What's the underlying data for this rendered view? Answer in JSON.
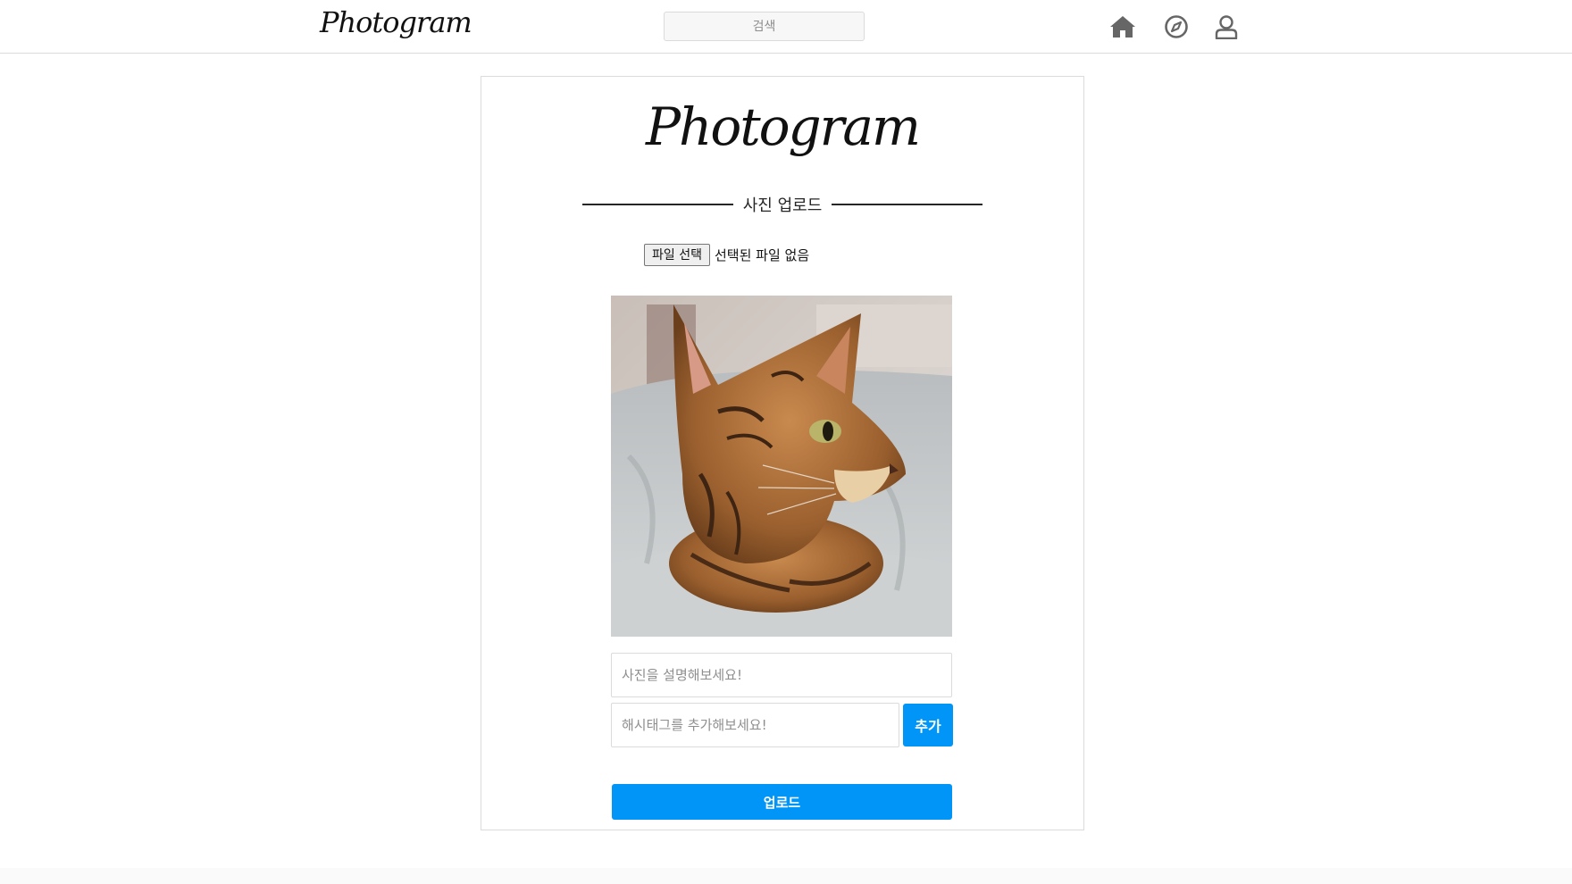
{
  "header": {
    "logo_text": "Photogram",
    "search_placeholder": "검색",
    "nav_icons": [
      "home-icon",
      "compass-icon",
      "user-icon"
    ]
  },
  "upload_card": {
    "logo_text": "Photogram",
    "section_title": "사진 업로드",
    "file_button_label": "파일 선택",
    "file_status": "선택된 파일 없음",
    "preview_image": "cat-photo-preview",
    "caption_placeholder": "사진을 설명해보세요!",
    "hashtag_placeholder": "해시태그를 추가해보세요!",
    "add_button_label": "추가",
    "upload_button_label": "업로드"
  },
  "colors": {
    "accent": "#0095f6",
    "border": "#dbdbdb",
    "icon_gray": "#666666"
  }
}
